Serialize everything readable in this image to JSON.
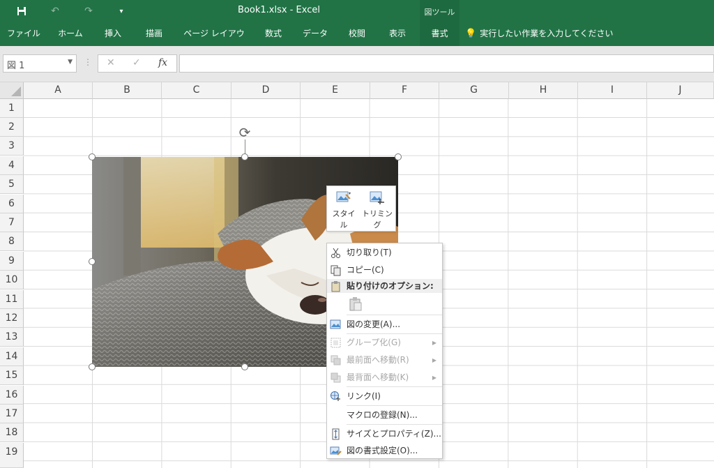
{
  "titlebar": {
    "title": "Book1.xlsx  -  Excel",
    "context_label": "図ツール",
    "qat": [
      "save-icon",
      "undo-icon",
      "redo-icon",
      "customize-icon"
    ]
  },
  "ribbon": {
    "tabs": [
      "ファイル",
      "ホーム",
      "挿入",
      "描画",
      "ページ レイアウト",
      "数式",
      "データ",
      "校閲",
      "表示",
      "書式"
    ],
    "active_tab": "書式",
    "tell_me": "実行したい作業を入力してください"
  },
  "formula_bar": {
    "name_box": "図 1",
    "cancel": "✕",
    "enter": "✓",
    "fx": "fx",
    "value": ""
  },
  "grid": {
    "columns": [
      "A",
      "B",
      "C",
      "D",
      "E",
      "F",
      "G",
      "H",
      "I",
      "J"
    ],
    "rows": [
      "1",
      "2",
      "3",
      "4",
      "5",
      "6",
      "7",
      "8",
      "9",
      "10",
      "11",
      "12",
      "13",
      "14",
      "15",
      "16",
      "17",
      "18",
      "19"
    ]
  },
  "mini_toolbar": {
    "style_label": "スタイ\nル",
    "style_label_line1": "スタイ",
    "style_label_line2": "ル",
    "crop_label": "トリミング"
  },
  "context_menu": {
    "items": [
      {
        "label": "切り取り(T)",
        "icon": "scissors-icon",
        "enabled": true
      },
      {
        "label": "コピー(C)",
        "icon": "copy-icon",
        "enabled": true
      },
      {
        "label": "貼り付けのオプション:",
        "icon": "paste-icon",
        "enabled": true
      },
      {
        "label": "図の変更(A)...",
        "icon": "change-picture-icon",
        "enabled": true
      },
      {
        "label": "グループ化(G)",
        "icon": "group-icon",
        "enabled": false
      },
      {
        "label": "最前面へ移動(R)",
        "icon": "bring-to-front-icon",
        "enabled": false
      },
      {
        "label": "最背面へ移動(K)",
        "icon": "send-to-back-icon",
        "enabled": false
      },
      {
        "label": "リンク(I)",
        "icon": "link-icon",
        "enabled": true
      },
      {
        "label": "マクロの登録(N)...",
        "icon": "",
        "enabled": true
      },
      {
        "label": "サイズとプロパティ(Z)...",
        "icon": "size-properties-icon",
        "enabled": true
      },
      {
        "label": "図の書式設定(O)...",
        "icon": "format-picture-icon",
        "enabled": true
      }
    ]
  },
  "colors": {
    "ribbon_green": "#217346",
    "active_tab_green": "#1e6a40"
  }
}
